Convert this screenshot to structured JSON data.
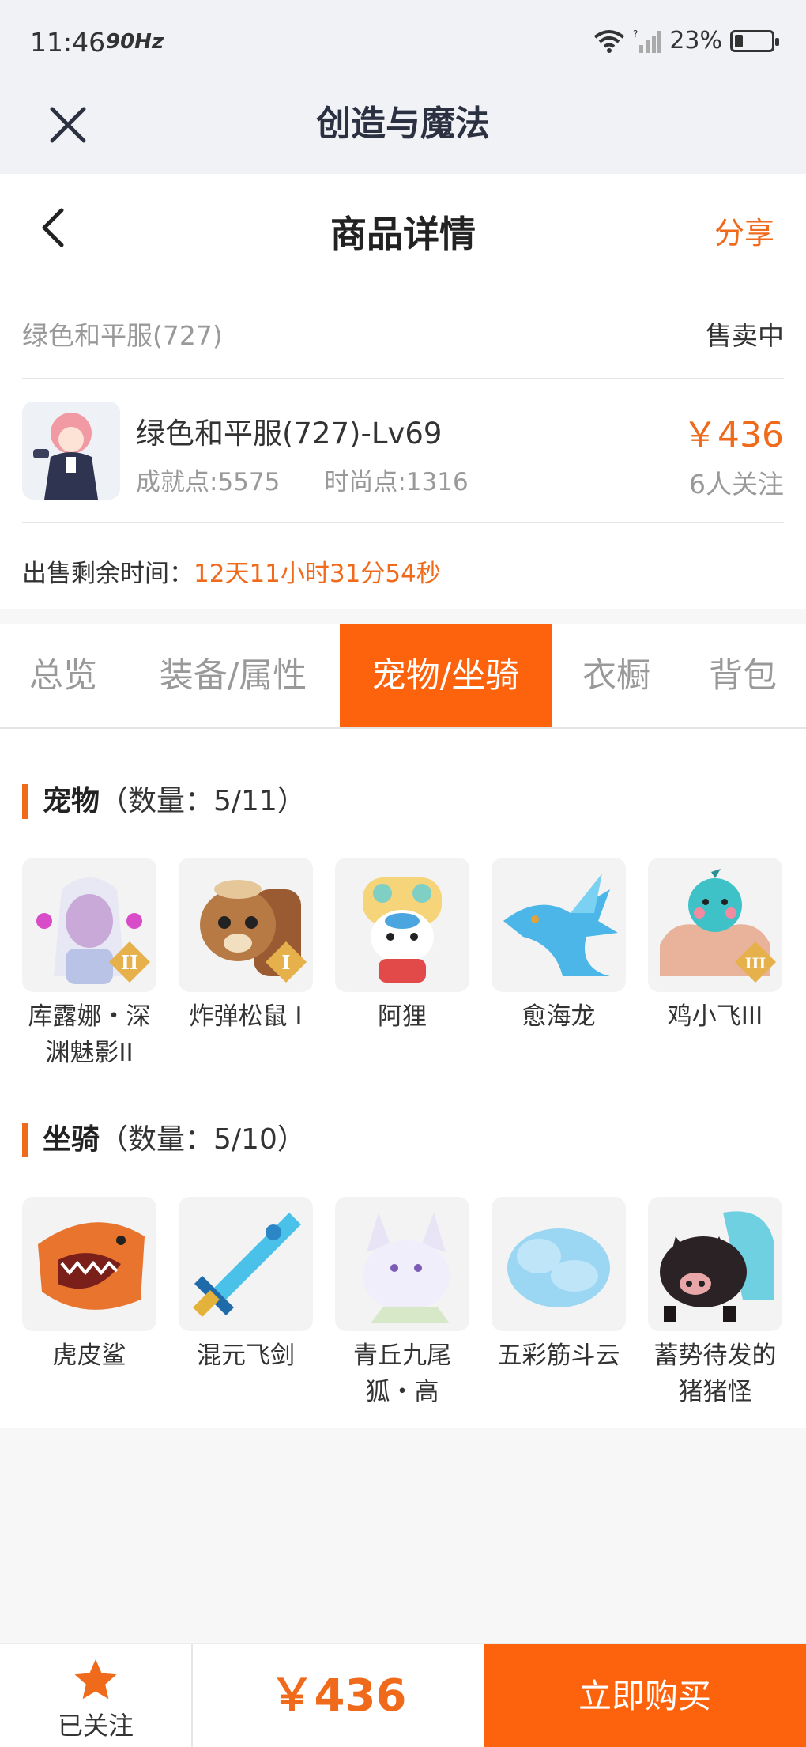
{
  "status_bar": {
    "time": "11:46",
    "refresh": "90Hz",
    "battery": "23%",
    "battery_level": 0.23
  },
  "app_bar": {
    "title": "创造与魔法"
  },
  "header": {
    "title": "商品详情",
    "share": "分享"
  },
  "info": {
    "server": "绿色和平服(727)",
    "status": "售卖中",
    "char_name": "绿色和平服(727)-Lv69",
    "achievement": "成就点:5575",
    "fashion": "时尚点:1316",
    "price": "￥436",
    "followers": "6人关注",
    "remain_label": "出售剩余时间：",
    "remain_value": "12天11小时31分54秒"
  },
  "tabs": [
    {
      "label": "总览"
    },
    {
      "label": "装备/属性"
    },
    {
      "label": "宠物/坐骑",
      "active": true
    },
    {
      "label": "衣橱"
    },
    {
      "label": "背包"
    }
  ],
  "pets": {
    "title": "宠物",
    "count": "（数量：5/11）",
    "items": [
      {
        "name": "库露娜・深渊魅影II",
        "badge": "II",
        "icon": "pet-kuluna-icon"
      },
      {
        "name": "炸弹松鼠 I",
        "badge": "I",
        "icon": "pet-squirrel-icon"
      },
      {
        "name": "阿狸",
        "icon": "pet-ali-icon"
      },
      {
        "name": "愈海龙",
        "icon": "pet-dragon-icon"
      },
      {
        "name": "鸡小飞III",
        "badge": "III",
        "icon": "pet-chick-icon"
      }
    ]
  },
  "mounts": {
    "title": "坐骑",
    "count": "（数量：5/10）",
    "items": [
      {
        "name": "虎皮鲨",
        "icon": "mount-shark-icon"
      },
      {
        "name": "混元飞剑",
        "icon": "mount-sword-icon"
      },
      {
        "name": "青丘九尾狐・高",
        "icon": "mount-fox-icon"
      },
      {
        "name": "五彩筋斗云",
        "icon": "mount-cloud-icon"
      },
      {
        "name": "蓄势待发的猪猪怪",
        "icon": "mount-pig-icon"
      }
    ]
  },
  "bottom": {
    "follow_label": "已关注",
    "price": "￥436",
    "buy": "立即购买"
  },
  "colors": {
    "accent": "#fd620c",
    "price": "#f06a1b"
  }
}
